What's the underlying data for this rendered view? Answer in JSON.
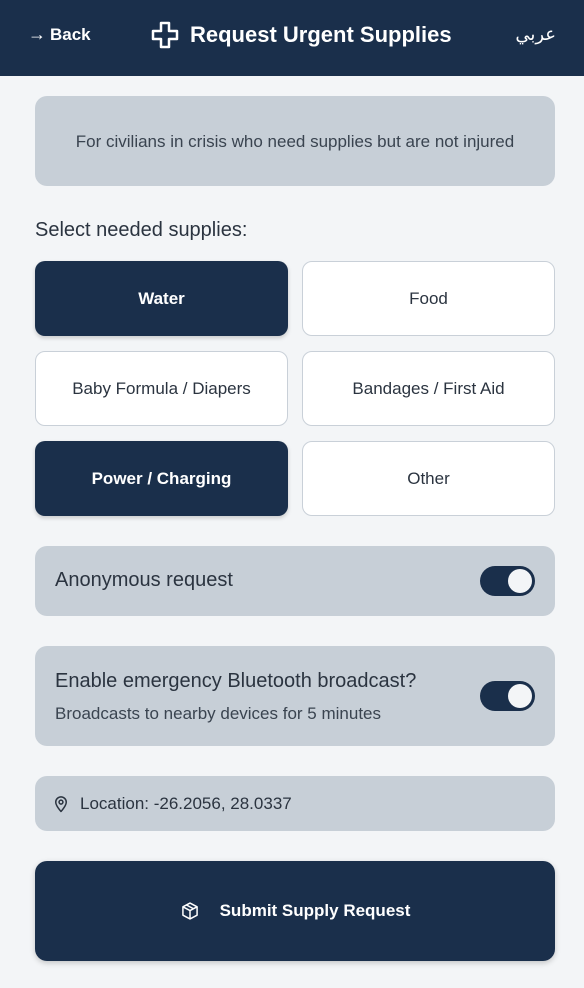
{
  "header": {
    "back_label": "Back",
    "back_arrow": "→",
    "title": "Request Urgent Supplies",
    "title_icon": "medical-cross-icon",
    "language_toggle": "عربي"
  },
  "info": {
    "text": "For civilians in crisis who need supplies but are not injured"
  },
  "supplies": {
    "label": "Select needed supplies:",
    "options": [
      {
        "label": "Water",
        "selected": true
      },
      {
        "label": "Food",
        "selected": false
      },
      {
        "label": "Baby Formula / Diapers",
        "selected": false
      },
      {
        "label": "Bandages / First Aid",
        "selected": false
      },
      {
        "label": "Power / Charging",
        "selected": true
      },
      {
        "label": "Other",
        "selected": false
      }
    ]
  },
  "anonymous": {
    "label": "Anonymous request",
    "enabled": true
  },
  "bluetooth": {
    "label": "Enable emergency Bluetooth broadcast?",
    "sublabel": "Broadcasts to nearby devices for 5 minutes",
    "enabled": true
  },
  "location": {
    "icon": "map-pin-icon",
    "text": "Location: -26.2056, 28.0337"
  },
  "submit": {
    "icon": "package-icon",
    "label": "Submit Supply Request"
  },
  "colors": {
    "primary": "#1a2f4b",
    "card": "#c7cfd7",
    "background": "#f3f5f7"
  }
}
